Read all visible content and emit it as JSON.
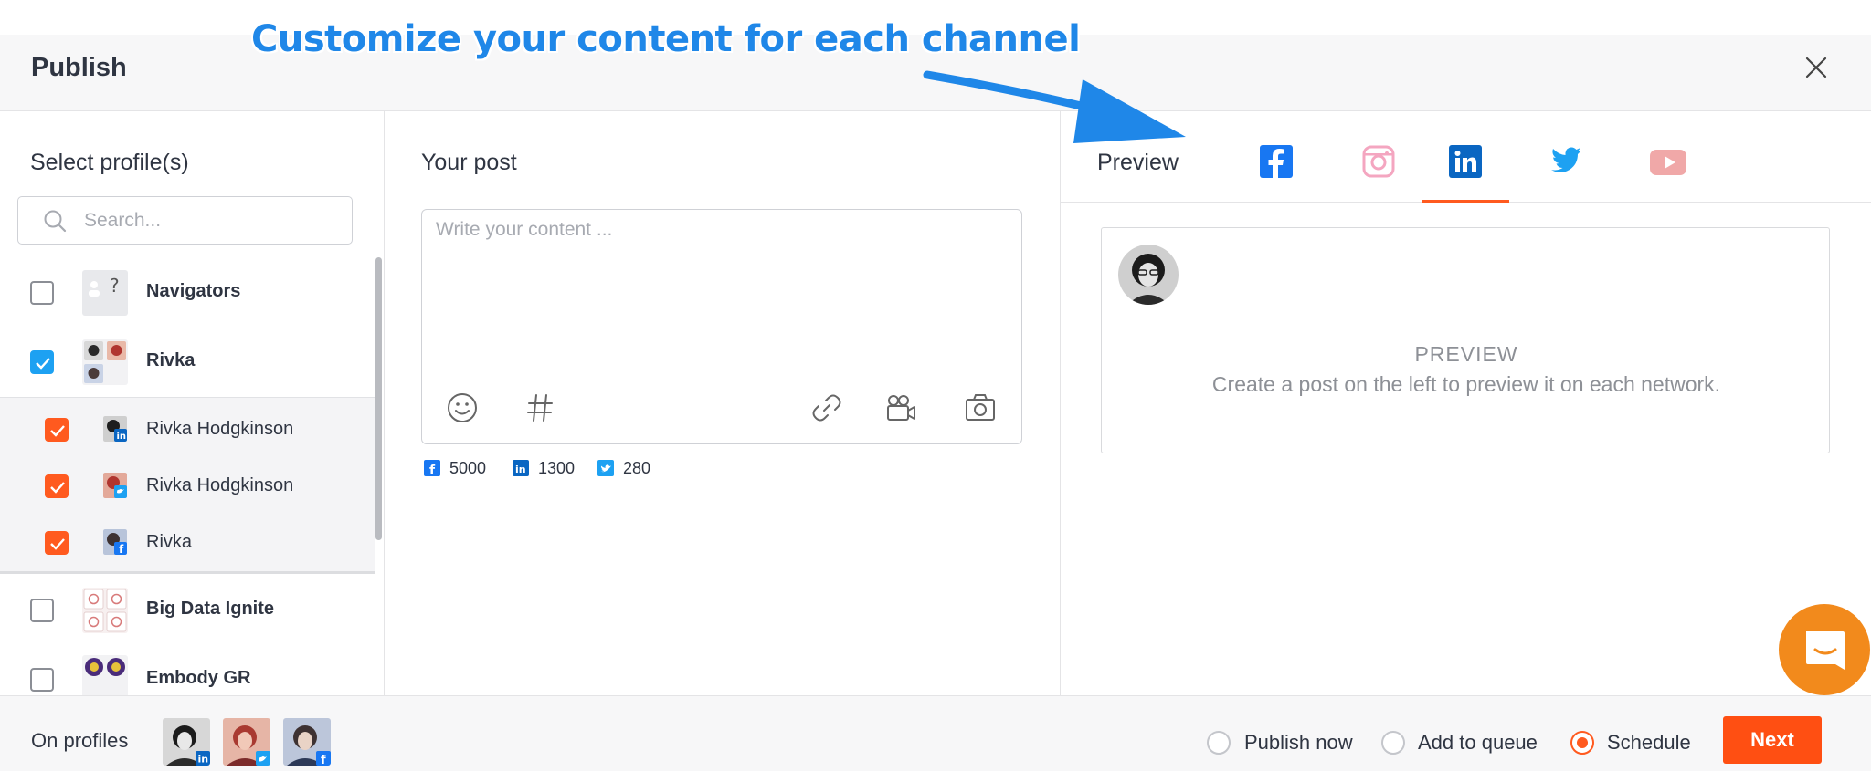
{
  "annotation": {
    "text": "Customize your content for each channel"
  },
  "header": {
    "title": "Publish"
  },
  "left": {
    "title": "Select profile(s)",
    "search_placeholder": "Search...",
    "groups": [
      {
        "label": "Navigators",
        "checked": false
      },
      {
        "label": "Rivka",
        "checked": true
      },
      {
        "label": "Big Data Ignite",
        "checked": false
      },
      {
        "label": "Embody GR",
        "checked": false
      }
    ],
    "sub_profiles": [
      {
        "label": "Rivka Hodgkinson",
        "network": "linkedin-icon",
        "checked": true
      },
      {
        "label": "Rivka Hodgkinson",
        "network": "twitter-icon",
        "checked": true
      },
      {
        "label": "Rivka",
        "network": "facebook-icon",
        "checked": true
      }
    ]
  },
  "middle": {
    "title": "Your post",
    "placeholder": "Write your content ...",
    "counts": [
      {
        "network": "facebook-icon",
        "value": "5000"
      },
      {
        "network": "linkedin-icon",
        "value": "1300"
      },
      {
        "network": "twitter-icon",
        "value": "280"
      }
    ]
  },
  "right": {
    "title": "Preview",
    "tabs": [
      "facebook-icon",
      "instagram-icon",
      "linkedin-icon",
      "twitter-icon",
      "youtube-icon"
    ],
    "active_tab": "linkedin-icon",
    "preview_heading": "PREVIEW",
    "preview_text": "Create a post on the left to preview it on each network."
  },
  "footer": {
    "label": "On profiles",
    "options": [
      {
        "label": "Publish now",
        "checked": false
      },
      {
        "label": "Add to queue",
        "checked": false
      },
      {
        "label": "Schedule",
        "checked": true
      }
    ],
    "next_label": "Next"
  },
  "colors": {
    "accent": "#ff5a1f",
    "annotation": "#1f87e8",
    "facebook": "#1877f2",
    "linkedin": "#0a66c2",
    "twitter": "#1da1f2",
    "chat": "#f28a1c"
  }
}
